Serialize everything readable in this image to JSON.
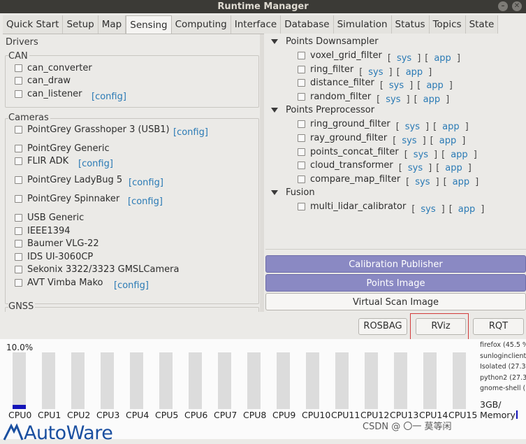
{
  "window": {
    "title": "Runtime Manager"
  },
  "tabs": [
    "Quick Start",
    "Setup",
    "Map",
    "Sensing",
    "Computing",
    "Interface",
    "Database",
    "Simulation",
    "Status",
    "Topics",
    "State"
  ],
  "active_tab": "Sensing",
  "left": {
    "drivers_title": "Drivers",
    "can": {
      "title": "CAN",
      "items": [
        "can_converter",
        "can_draw",
        "can_listener"
      ],
      "config": "[config]"
    },
    "cameras": {
      "title": "Cameras",
      "items": [
        "PointGrey Grasshoper 3 (USB1)",
        "PointGrey Generic",
        "FLIR ADK",
        "PointGrey LadyBug 5",
        "PointGrey Spinnaker",
        "USB Generic",
        "IEEE1394",
        "Baumer VLG-22",
        "IDS UI-3060CP",
        "Sekonix 3322/3323 GMSLCamera",
        "AVT Vimba Mako"
      ],
      "config": "[config]"
    },
    "gnss_title": "GNSS"
  },
  "right": {
    "sections": [
      {
        "title": "Points Downsampler",
        "items": [
          "voxel_grid_filter",
          "ring_filter",
          "distance_filter",
          "random_filter"
        ]
      },
      {
        "title": "Points Preprocessor",
        "items": [
          "ring_ground_filter",
          "ray_ground_filter",
          "points_concat_filter",
          "cloud_transformer",
          "compare_map_filter"
        ]
      },
      {
        "title": "Fusion",
        "items": [
          "multi_lidar_calibrator"
        ]
      }
    ],
    "sys_label": "sys",
    "app_label": "app",
    "lb": "[",
    "rb": "]",
    "buttons": {
      "calibration_publisher": "Calibration Publisher",
      "points_image": "Points Image",
      "virtual_scan_image": "Virtual Scan Image"
    }
  },
  "toolbar": {
    "rosbag": "ROSBAG",
    "rviz": "RViz",
    "rqt": "RQT"
  },
  "monitor": {
    "cpu_percent_label": "10.0%",
    "cpus": [
      {
        "label": "CPU0",
        "usage": 0.08
      },
      {
        "label": "CPU1",
        "usage": 0
      },
      {
        "label": "CPU2",
        "usage": 0
      },
      {
        "label": "CPU3",
        "usage": 0
      },
      {
        "label": "CPU4",
        "usage": 0
      },
      {
        "label": "CPU5",
        "usage": 0
      },
      {
        "label": "CPU6",
        "usage": 0
      },
      {
        "label": "CPU7",
        "usage": 0
      },
      {
        "label": "CPU8",
        "usage": 0
      },
      {
        "label": "CPU9",
        "usage": 0
      },
      {
        "label": "CPU10",
        "usage": 0
      },
      {
        "label": "CPU11",
        "usage": 0
      },
      {
        "label": "CPU12",
        "usage": 0
      },
      {
        "label": "CPU13",
        "usage": 0
      },
      {
        "label": "CPU14",
        "usage": 0
      },
      {
        "label": "CPU15",
        "usage": 0
      }
    ],
    "processes": [
      "firefox (45.5 %",
      "sunloginclient_",
      "Isolated (27.3 %",
      "python2 (27.3 %",
      "gnome-shell (1"
    ],
    "memory_value": "3GB/",
    "memory_label": "Memory"
  },
  "logo_text": "AutoWare",
  "watermark": "CSDN @ 〇一 莫等闲"
}
